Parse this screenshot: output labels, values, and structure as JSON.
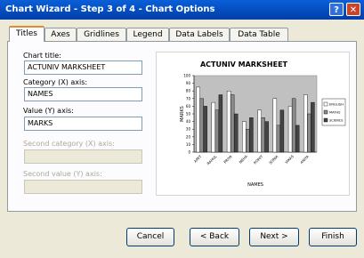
{
  "window": {
    "title": "Chart Wizard - Step 3 of 4 - Chart Options"
  },
  "tabs": [
    {
      "label": "Titles",
      "active": true
    },
    {
      "label": "Axes",
      "active": false
    },
    {
      "label": "Gridlines",
      "active": false
    },
    {
      "label": "Legend",
      "active": false
    },
    {
      "label": "Data Labels",
      "active": false
    },
    {
      "label": "Data Table",
      "active": false
    }
  ],
  "fields": {
    "chart_title": {
      "label": "Chart title:",
      "value": "ACTUNIV MARKSHEET"
    },
    "category_x": {
      "label": "Category (X) axis:",
      "value": "NAMES"
    },
    "value_y": {
      "label": "Value (Y) axis:",
      "value": "MARKS"
    },
    "second_category": {
      "label": "Second category (X) axis:",
      "value": ""
    },
    "second_value": {
      "label": "Second value (Y) axis:",
      "value": ""
    }
  },
  "chart_data": {
    "type": "bar",
    "title": "ACTUNIV MARKSHEET",
    "xlabel": "NAMES",
    "ylabel": "MARKS",
    "ylim": [
      0,
      100
    ],
    "categories": [
      "AMIT",
      "RAHUL",
      "PRIYA",
      "NEHA",
      "ROHIT",
      "SONIA",
      "VIKAS",
      "ANITA"
    ],
    "series": [
      {
        "name": "ENGLISH",
        "values": [
          85,
          65,
          80,
          40,
          55,
          70,
          60,
          75
        ]
      },
      {
        "name": "MATHS",
        "values": [
          70,
          55,
          75,
          30,
          45,
          35,
          70,
          50
        ]
      },
      {
        "name": "SCIENCE",
        "values": [
          60,
          75,
          50,
          45,
          40,
          55,
          35,
          65
        ]
      }
    ],
    "legend_position": "right",
    "plot_area_color": "#c0c0c0",
    "series_colors": [
      "#ffffff",
      "#8a8a8a",
      "#444444"
    ]
  },
  "buttons": {
    "cancel": "Cancel",
    "back": "< Back",
    "next": "Next >",
    "finish": "Finish"
  }
}
